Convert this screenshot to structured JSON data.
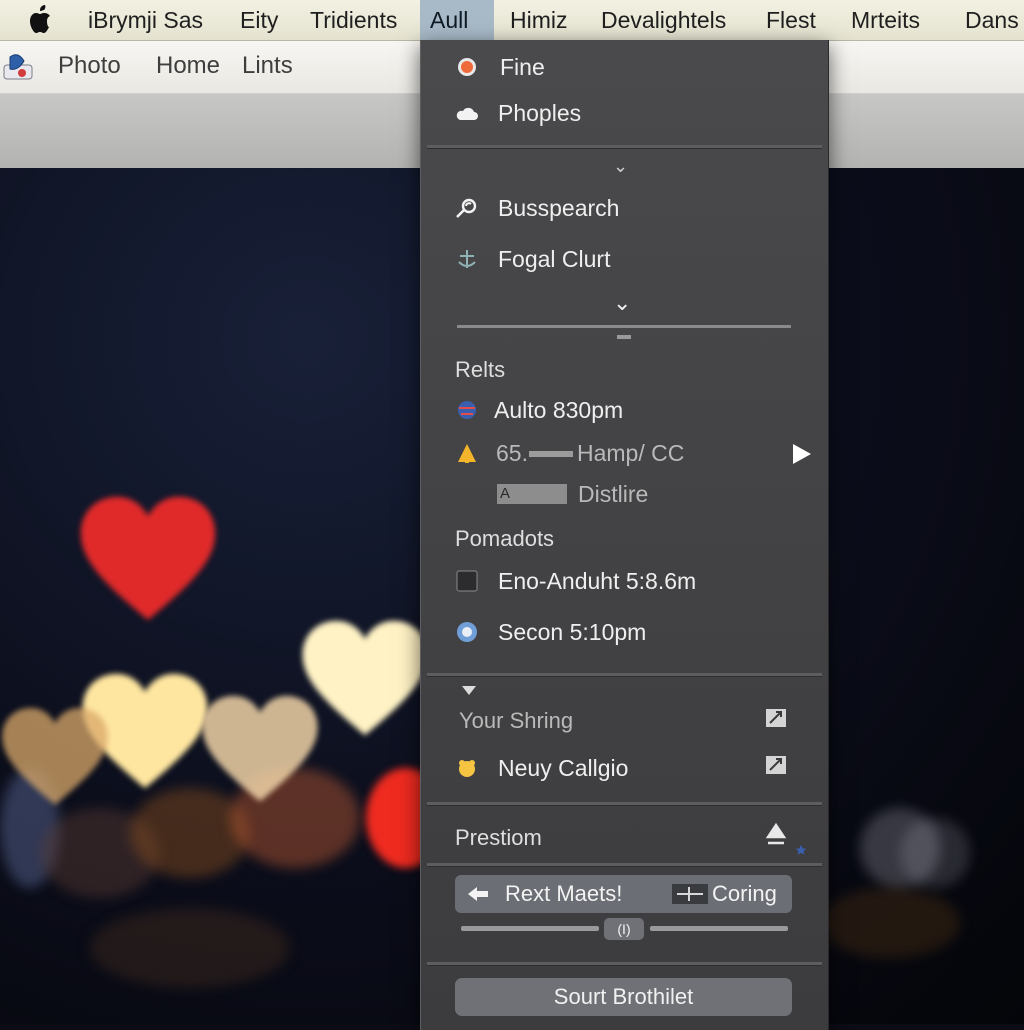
{
  "menubar": {
    "apple_icon": "apple-logo-icon",
    "items": [
      "iBrymji Sas",
      "Eity",
      "Tridients",
      "Aull",
      "Himiz",
      "Devalightels",
      "Flest",
      "Mrteits",
      "Dans"
    ],
    "active_item": "Aull",
    "active_color": "#a8b9c7"
  },
  "toolbar": {
    "app_icon": "app-logo-icon",
    "items": [
      "Photo",
      "Home",
      "Lints"
    ]
  },
  "menu": {
    "top_items": [
      {
        "label": "Fine",
        "icon": "orange-badge-icon"
      },
      {
        "label": "Phoples",
        "icon": "cloud-icon"
      }
    ],
    "mid_items": [
      {
        "label": "Busspearch",
        "icon": "search-swirl-icon"
      },
      {
        "label": "Fogal Clurt",
        "icon": "anchor-icon"
      }
    ],
    "section_relts": "Relts",
    "relts_items": [
      {
        "label": "Aulto 830pm",
        "icon": "globe-icon"
      },
      {
        "label": "65.",
        "label2": "Hamp/ CC",
        "icon": "bell-icon",
        "submenu_icon": "play-triangle-icon"
      },
      {
        "label": "Distlire",
        "icon": "placeholder-box-icon",
        "box_text": "A"
      }
    ],
    "section_pomadots": "Pomadots",
    "pomadots_items": [
      {
        "label": "Eno-Anduht 5:8.6m",
        "icon": "square-icon"
      },
      {
        "label": "Secon 5:10pm",
        "icon": "round-badge-icon"
      }
    ],
    "section_your": "Your Shring",
    "your_items": [
      {
        "label": "Neuy Callgio",
        "icon": "crown-icon"
      }
    ],
    "section_prestiom": "Prestiom",
    "rext_label": "Rext Maets!",
    "coring_label": "Coring",
    "slider_label": "(I)",
    "bottom_button": "Sourt Brothilet"
  }
}
